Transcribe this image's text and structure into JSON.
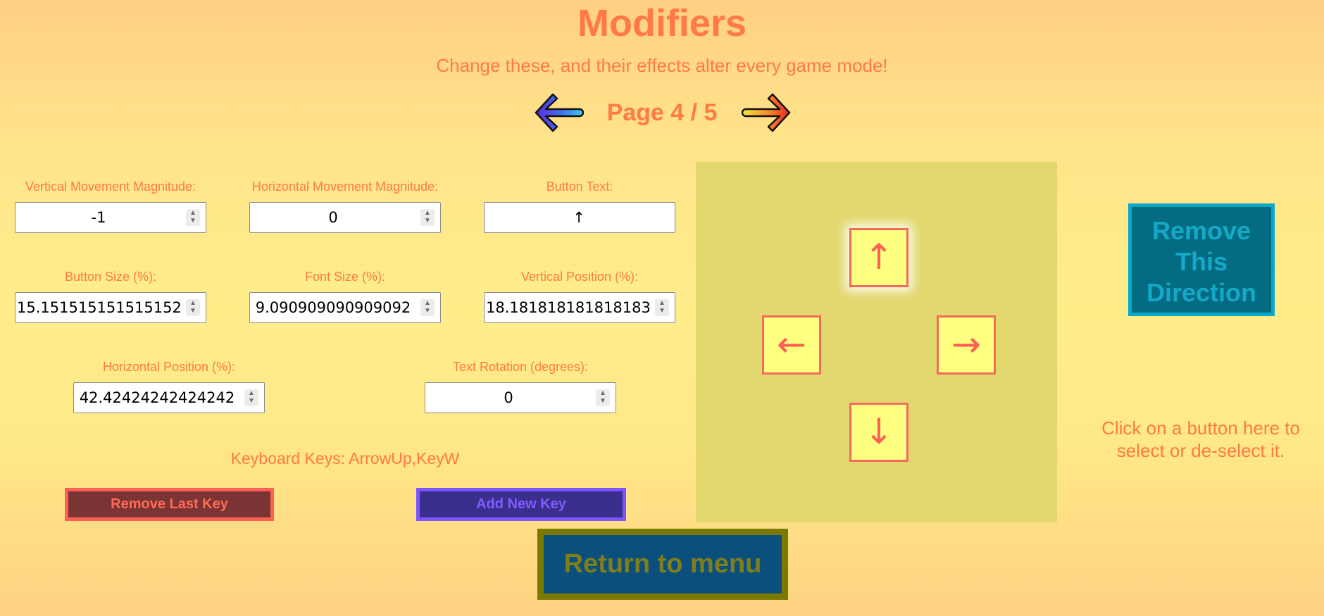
{
  "header": {
    "title": "Modifiers",
    "subtitle": "Change these, and their effects alter every game mode!",
    "page_label": "Page 4 / 5",
    "prev_icon": "arrow-left-icon",
    "next_icon": "arrow-right-icon"
  },
  "fields": {
    "vertical_magnitude": {
      "label": "Vertical Movement Magnitude:",
      "value": "-1"
    },
    "horizontal_magnitude": {
      "label": "Horizontal Movement Magnitude:",
      "value": "0"
    },
    "button_text": {
      "label": "Button Text:",
      "value": "↑"
    },
    "button_size": {
      "label": "Button Size (%):",
      "value": "15.151515151515152"
    },
    "font_size": {
      "label": "Font Size (%):",
      "value": "9.090909090909092"
    },
    "vertical_position": {
      "label": "Vertical Position (%):",
      "value": "18.181818181818183"
    },
    "horizontal_position": {
      "label": "Horizontal Position (%):",
      "value": "42.42424242424242"
    },
    "text_rotation": {
      "label": "Text Rotation (degrees):",
      "value": "0"
    }
  },
  "keys": {
    "text": "Keyboard Keys: ArrowUp,KeyW",
    "remove_label": "Remove Last Key",
    "add_label": "Add New Key"
  },
  "preview": {
    "up": "↑",
    "left": "←",
    "right": "→",
    "down": "↓",
    "selected": "up"
  },
  "side": {
    "remove_direction_label": "Remove This Direction",
    "hint": "Click on a button here to select or de-select it."
  },
  "footer": {
    "return_label": "Return to menu"
  },
  "colors": {
    "accent": "#ff7a45",
    "preview_bg": "#e2d86e",
    "dir_button_bg": "#ffff80",
    "remove_key_bg": "#7a3434",
    "add_key_bg": "#3b2f8e",
    "remove_direction_bg": "#036b82",
    "return_bg": "#0b4f7c"
  }
}
